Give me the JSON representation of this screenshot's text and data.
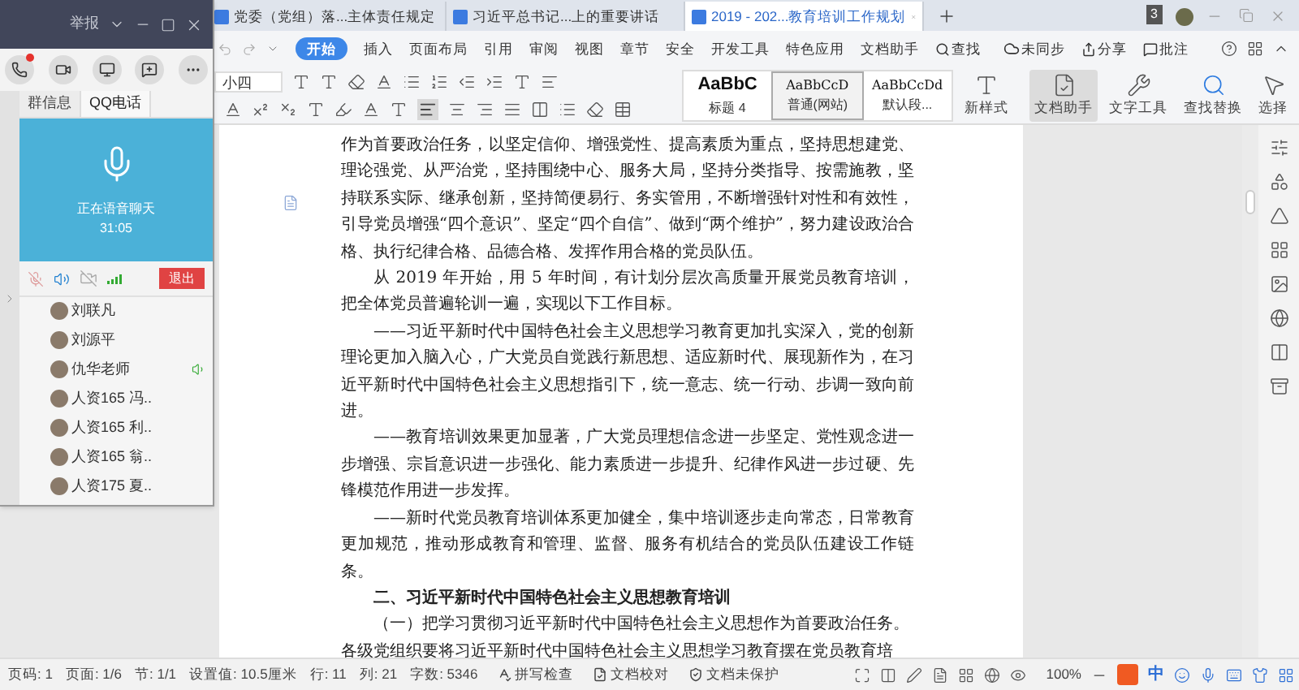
{
  "wps": {
    "tabs": [
      {
        "title": "党委（党组）落...主体责任规定",
        "selected": false
      },
      {
        "title": "习近平总书记...上的重要讲话",
        "selected": false
      },
      {
        "title": "2019 - 202...教育培训工作规划",
        "selected": true
      }
    ],
    "window_count": "3",
    "menu": [
      {
        "label": "开始",
        "selected": true
      },
      {
        "label": "插入",
        "selected": false
      },
      {
        "label": "页面布局",
        "selected": false
      },
      {
        "label": "引用",
        "selected": false
      },
      {
        "label": "审阅",
        "selected": false
      },
      {
        "label": "视图",
        "selected": false
      },
      {
        "label": "章节",
        "selected": false
      },
      {
        "label": "安全",
        "selected": false
      },
      {
        "label": "开发工具",
        "selected": false
      },
      {
        "label": "特色应用",
        "selected": false
      },
      {
        "label": "文档助手",
        "selected": false
      }
    ],
    "search": "查找",
    "sync": "未同步",
    "share": "分享",
    "comment": "批注",
    "font_size": "小四",
    "styles": [
      {
        "preview": "AaBbC",
        "name": "标题 4",
        "selected": false
      },
      {
        "preview": "AaBbCcD",
        "name": "普通(网站)",
        "selected": true
      },
      {
        "preview": "AaBbCcDd",
        "name": "默认段...",
        "selected": false
      }
    ],
    "tools": [
      {
        "kind": "newstyle",
        "label": "新样式",
        "active": false
      },
      {
        "kind": "assistant",
        "label": "文档助手",
        "active": true
      },
      {
        "kind": "texttools",
        "label": "文字工具",
        "active": false
      },
      {
        "kind": "replace",
        "label": "查找替换",
        "active": false
      },
      {
        "kind": "select",
        "label": "选择",
        "active": false
      }
    ],
    "document": [
      {
        "kind": "continuation",
        "text": "作为首要政治任务，以坚定信仰、增强党性、提高素质为重点，坚持思想建党、理论强党、从严治党，坚持围绕中心、服务大局，坚持分类指导、按需施教，坚持联系实际、继承创新，坚持简便易行、务实管用，不断增强针对性和有效性，引导党员增强“四个意识”、坚定“四个自信”、做到“两个维护”，努力建设政治合格、执行纪律合格、品德合格、发挥作用合格的党员队伍。"
      },
      {
        "kind": "body",
        "text": "从 2019 年开始，用 5 年时间，有计划分层次高质量开展党员教育培训，把全体党员普遍轮训一遍，实现以下工作目标。"
      },
      {
        "kind": "body",
        "text": "——习近平新时代中国特色社会主义思想学习教育更加扎实深入，党的创新理论更加入脑入心，广大党员自觉践行新思想、适应新时代、展现新作为，在习近平新时代中国特色社会主义思想指引下，统一意志、统一行动、步调一致向前进。"
      },
      {
        "kind": "body",
        "text": "——教育培训效果更加显著，广大党员理想信念进一步坚定、党性观念进一步增强、宗旨意识进一步强化、能力素质进一步提升、纪律作风进一步过硬、先锋模范作用进一步发挥。"
      },
      {
        "kind": "body",
        "text": "——新时代党员教育培训体系更加健全，集中培训逐步走向常态，日常教育更加规范，推动形成教育和管理、监督、服务有机结合的党员队伍建设工作链条。"
      },
      {
        "kind": "heading",
        "text": "二、习近平新时代中国特色社会主义思想教育培训"
      },
      {
        "kind": "body",
        "text": "（一）把学习贯彻习近平新时代中国特色社会主义思想作为首要政治任务。"
      },
      {
        "kind": "continuation",
        "text": "各级党组织要将习近平新时代中国特色社会主义思想学习教育摆在党员教育培"
      }
    ],
    "status_bar": [
      "页码: 1",
      "页面: 1/6",
      "节: 1/1",
      "设置值: 10.5厘米",
      "行: 11",
      "列: 21",
      "字数: 5346"
    ],
    "status_tools": [
      "拼写检查",
      "文档校对",
      "文档未保护"
    ],
    "zoom": "100%",
    "ime": "中"
  },
  "qq_window": {
    "report": "举报",
    "call_alert": true,
    "tabs": [
      {
        "label": "群信息",
        "selected": false
      },
      {
        "label": "QQ电话",
        "selected": true
      }
    ],
    "call_status": "正在语音聊天",
    "duration": "31:05",
    "mic_muted": true,
    "exit": "退出",
    "members": [
      {
        "name": "刘联凡",
        "speaking": false
      },
      {
        "name": "刘源平",
        "speaking": false
      },
      {
        "name": "仇华老师",
        "speaking": true
      },
      {
        "name": "人资165 冯..",
        "speaking": false
      },
      {
        "name": "人资165 利..",
        "speaking": false
      },
      {
        "name": "人资165 翁..",
        "speaking": false
      },
      {
        "name": "人资175 夏..",
        "speaking": false
      }
    ]
  }
}
